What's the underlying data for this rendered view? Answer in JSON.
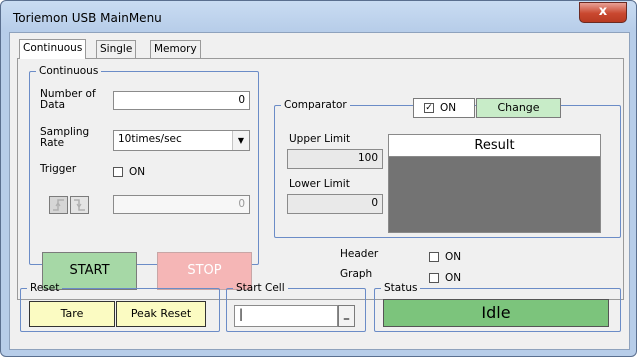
{
  "window": {
    "title": "Toriemon USB MainMenu",
    "close_glyph": "x"
  },
  "tabs": [
    {
      "label": "Continuous",
      "active": true
    },
    {
      "label": "Single",
      "active": false
    },
    {
      "label": "Memory",
      "active": false
    }
  ],
  "continuous": {
    "group_label": "Continuous",
    "num_data_label": "Number of Data",
    "num_data_value": "0",
    "sampling_label": "Sampling Rate",
    "sampling_value": "10times/sec",
    "trigger_label": "Trigger",
    "trigger_on_label": "ON",
    "trigger_checked": false,
    "level_value": "0",
    "rise_icon": "rising-edge-icon",
    "fall_icon": "falling-edge-icon",
    "start_label": "START",
    "stop_label": "STOP"
  },
  "comparator": {
    "group_label": "Comparator",
    "on_label": "ON",
    "on_checked": true,
    "change_label": "Change",
    "upper_label": "Upper Limit",
    "upper_value": "100",
    "lower_label": "Lower Limit",
    "lower_value": "0",
    "result_label": "Result"
  },
  "options": {
    "header_label": "Header",
    "header_on_label": "ON",
    "header_checked": false,
    "graph_label": "Graph",
    "graph_on_label": "ON",
    "graph_checked": false
  },
  "reset": {
    "group_label": "Reset",
    "tare_label": "Tare",
    "peak_reset_label": "Peak Reset"
  },
  "start_cell": {
    "group_label": "Start Cell",
    "value": "",
    "button_label": "_"
  },
  "status": {
    "group_label": "Status",
    "value": "Idle"
  },
  "colors": {
    "start_green": "#a6d8a6",
    "stop_pink": "#f5b6b6",
    "yellow": "#fbfbc2",
    "status_green": "#7cc47c"
  }
}
